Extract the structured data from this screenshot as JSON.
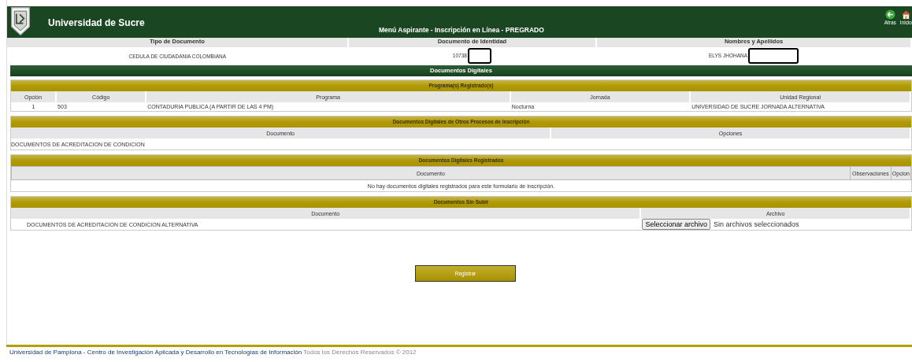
{
  "header": {
    "title": "Universidad de Sucre",
    "subtitle": "Menú Aspirante - Inscripción en Línea - PREGRADO",
    "nav": [
      {
        "kind": "back",
        "label": "Atras"
      },
      {
        "kind": "home",
        "label": "Inicio"
      }
    ]
  },
  "applicant": {
    "columns": [
      "Tipo de Documento",
      "Documento de Identidad",
      "Nombres y Apellidos"
    ],
    "values": [
      {
        "text": "CEDULA DE CIUDADANIA COLOMBIANA",
        "redacted": false
      },
      {
        "text": "10738",
        "redacted": true
      },
      {
        "text": "ELYS JHOHANA",
        "redacted": true
      }
    ]
  },
  "section_title": "Documentos Digitales",
  "programs": {
    "title": "Programa(s) Registrado(s)",
    "columns": [
      "Opción",
      "Código",
      "Programa",
      "Jornada",
      "Unidad Regional"
    ],
    "rows": [
      [
        "1",
        "503",
        "CONTADURIA PUBLICA (A PARTIR DE LAS 4 PM)",
        "Nocturna",
        "UNIVERSIDAD DE SUCRE JORNADA ALTERNATIVA"
      ]
    ]
  },
  "other_processes": {
    "title": "Documentos Digitales de Otros Procesos de Inscripción",
    "columns": [
      "Documento",
      "Opciones"
    ],
    "rows": [
      [
        "DOCUMENTOS DE ACREDITACION DE CONDICION"
      ]
    ]
  },
  "registered": {
    "title": "Documentos Digitales Registrados",
    "columns": [
      "Documento",
      "Observaciones",
      "Opcion"
    ],
    "empty_message": "No hay documentos digitales registrados para este formulario de inscripción."
  },
  "pending": {
    "title": "Documentos Sin Subir",
    "columns": [
      "Documento",
      "Archivo"
    ],
    "rows": [
      {
        "document": "DOCUMENTOS DE ACREDITACION DE CONDICION ALTERNATIVA",
        "file_button": "Seleccionar archivo",
        "file_status": "Sin archivos seleccionados"
      }
    ]
  },
  "submit_button": "Registrar",
  "footer": {
    "link": "Universidad de Pamplona - Centro de Investigación Aplicada y Desarrollo en Tecnologías de Información",
    "text": "Todos los Derechos Reservados © 2012"
  }
}
